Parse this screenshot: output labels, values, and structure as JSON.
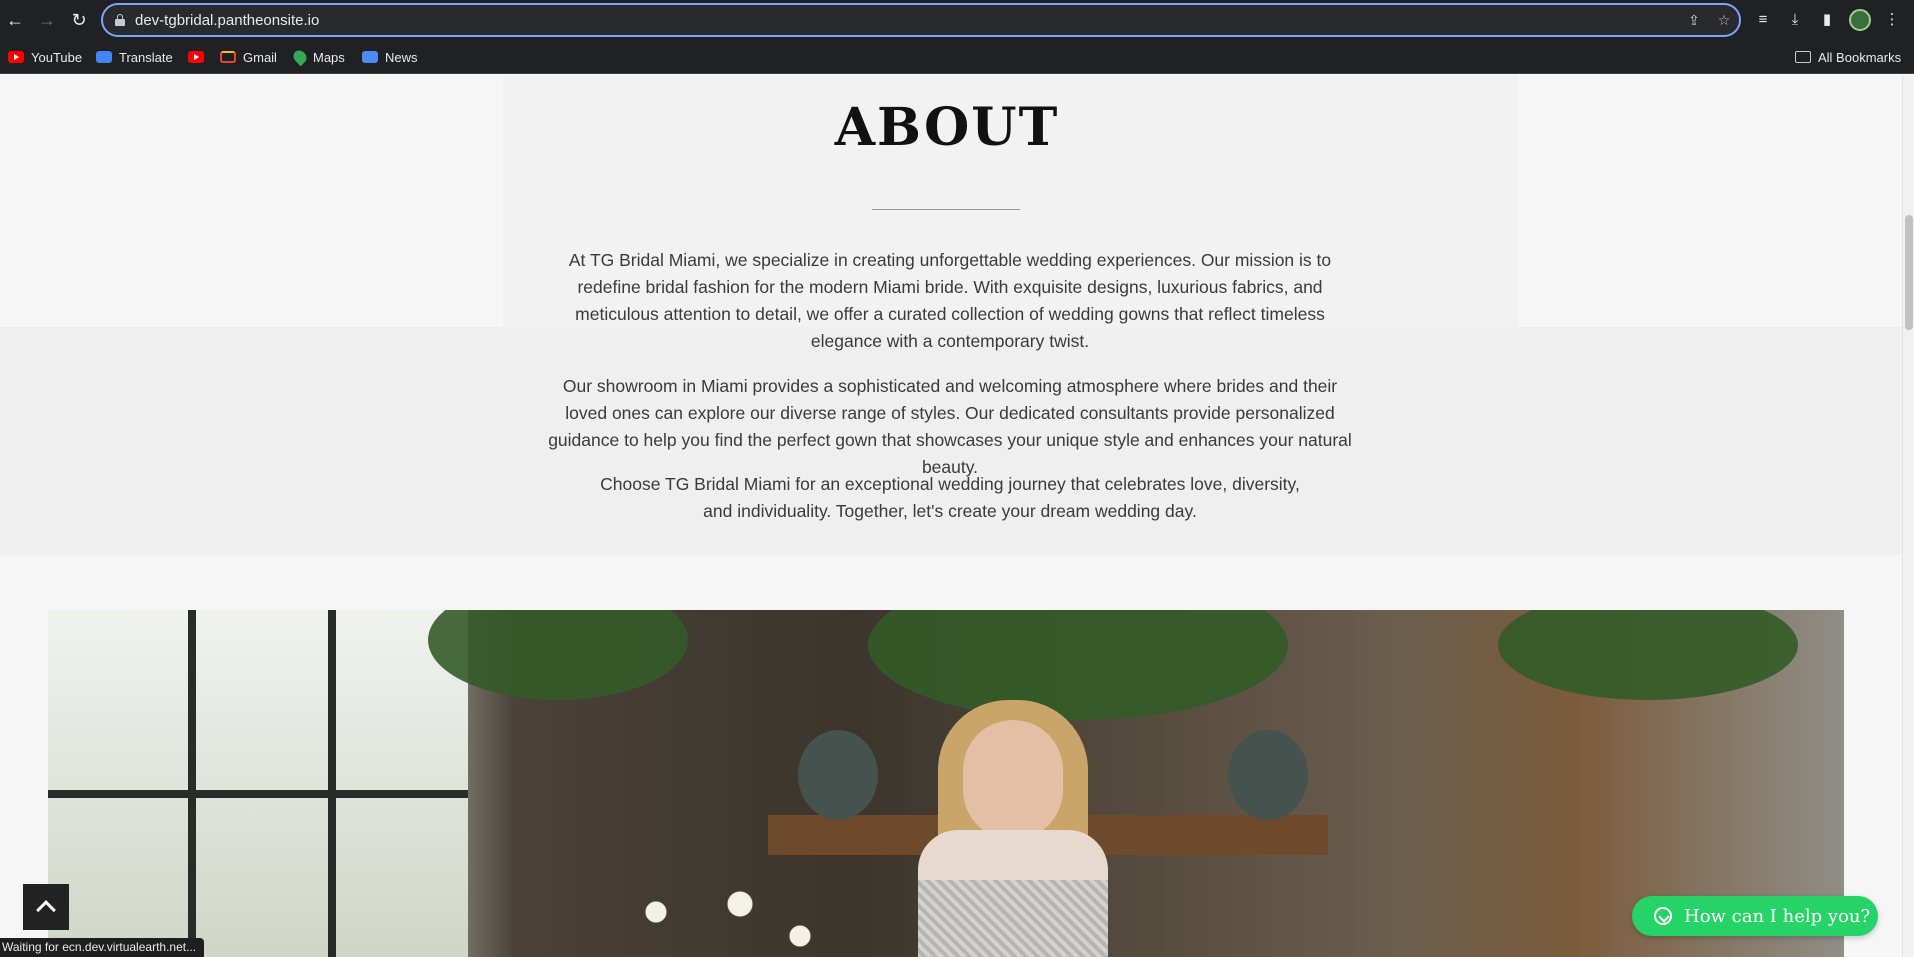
{
  "browser": {
    "url": "dev-tgbridal.pantheonsite.io",
    "bookmarks": [
      {
        "label": "YouTube",
        "icon": "youtube-icon"
      },
      {
        "label": "Translate",
        "icon": "translate-icon"
      },
      {
        "label": "",
        "icon": "youtube-icon"
      },
      {
        "label": "Gmail",
        "icon": "gmail-icon"
      },
      {
        "label": "Maps",
        "icon": "maps-icon"
      },
      {
        "label": "News",
        "icon": "news-icon"
      }
    ],
    "all_bookmarks": "All Bookmarks",
    "status": "Waiting for ecn.dev.virtualearth.net..."
  },
  "about": {
    "title": "ABOUT",
    "paragraphs": [
      "At TG Bridal Miami, we specialize in creating unforgettable wedding experiences. Our mission is to redefine bridal fashion for the modern Miami bride. With exquisite designs, luxurious fabrics, and meticulous attention to detail, we offer a curated collection of wedding gowns that reflect timeless elegance with a contemporary twist.",
      "Our showroom in Miami provides a sophisticated and welcoming atmosphere where brides and their loved ones can explore our diverse range of styles. Our dedicated consultants provide personalized guidance to help you find the perfect gown that showcases your unique style and enhances your natural beauty.",
      "Choose TG Bridal Miami for an exceptional wedding journey that celebrates love, diversity, and individuality. Together, let's create your dream wedding day."
    ]
  },
  "whatsapp": {
    "label": "How can I help you?"
  },
  "colors": {
    "whatsapp": "#25d366",
    "chrome": "#202124",
    "focus": "#7ea6f7"
  }
}
